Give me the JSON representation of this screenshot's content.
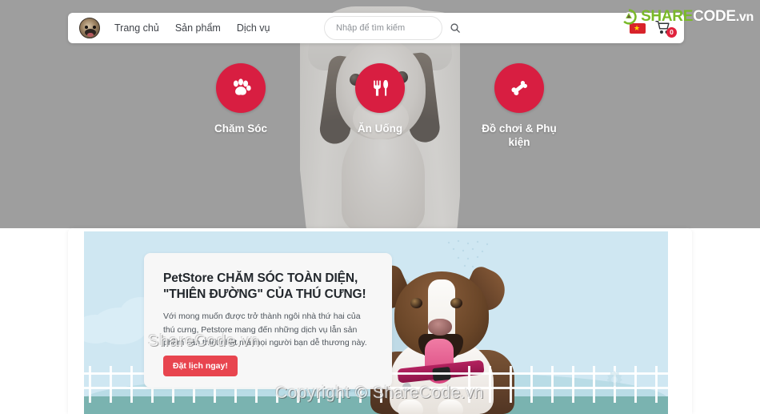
{
  "header": {
    "logo_icon": "pug-avatar-icon",
    "nav": [
      {
        "label": "Trang chủ"
      },
      {
        "label": "Sản phẩm"
      },
      {
        "label": "Dịch vụ"
      }
    ],
    "search": {
      "placeholder": "Nhập để tìm kiếm",
      "value": "",
      "icon": "search-icon"
    },
    "flag_icon": "vietnam-flag-icon",
    "cart": {
      "icon": "shopping-cart-icon",
      "badge_count": "0"
    }
  },
  "watermark": {
    "brand_share": "SHARE",
    "brand_code": "CODE",
    "brand_tld": ".vn",
    "mid_text": "ShareCode.vn",
    "copyright": "Copyright © ShareCode.vn",
    "logo_icon": "sharecode-logo-icon"
  },
  "categories": [
    {
      "label": "Chăm Sóc",
      "icon": "paw-icon"
    },
    {
      "label": "Ăn Uống",
      "icon": "fork-knife-icon"
    },
    {
      "label": "Đồ chơi & Phụ kiện",
      "icon": "bone-toy-icon"
    }
  ],
  "banner": {
    "headline_line1": "PetStore CHĂM SÓC TOÀN DIỆN,",
    "headline_line2": "\"THIÊN ĐƯỜNG\" CỦA THÚ CƯNG!",
    "paragraph": "Với mong muốn được trở thành ngôi nhà thứ hai của thú cưng, Petstore mang đến những dịch vụ lẫn sản phẩm cần thiết nhất mà mọi người bạn dễ thương này.",
    "cta_label": "Đặt lịch ngay!",
    "decor_gear_icon": "gear-icon",
    "dog_image": "border-collie-photo"
  },
  "colors": {
    "accent_red": "#d81e41",
    "cta_red": "#e8454f",
    "hero_gray": "#9e9e9e",
    "banner_sky": "#cfe7f2",
    "banner_ground": "#7ab3b0",
    "brand_green": "#7ab929"
  }
}
